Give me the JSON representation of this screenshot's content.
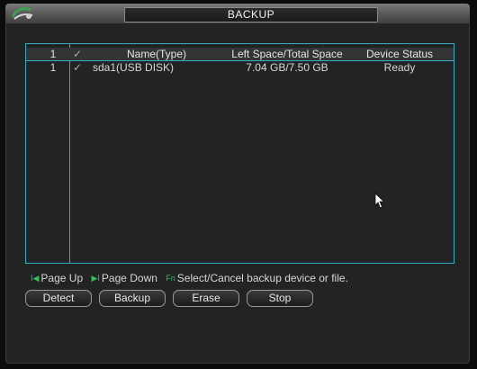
{
  "window": {
    "title": "BACKUP"
  },
  "table": {
    "header": {
      "num": "1",
      "check": "✓",
      "name": "Name(Type)",
      "space": "Left Space/Total Space",
      "status": "Device Status"
    },
    "rows": [
      {
        "num": "1",
        "check": "✓",
        "name": "sda1(USB DISK)",
        "space": "7.04 GB/7.50 GB",
        "status": "Ready"
      }
    ]
  },
  "hints": {
    "page_up_icon": "I◀",
    "page_up": "Page Up",
    "page_down_icon": "▶I",
    "page_down": "Page Down",
    "fn_icon": "Fn",
    "fn_text": "Select/Cancel backup device or file."
  },
  "buttons": {
    "detect": "Detect",
    "backup": "Backup",
    "erase": "Erase",
    "stop": "Stop"
  },
  "colors": {
    "accent_border": "#3aa9c4",
    "hint_icon": "#2fc25b"
  }
}
